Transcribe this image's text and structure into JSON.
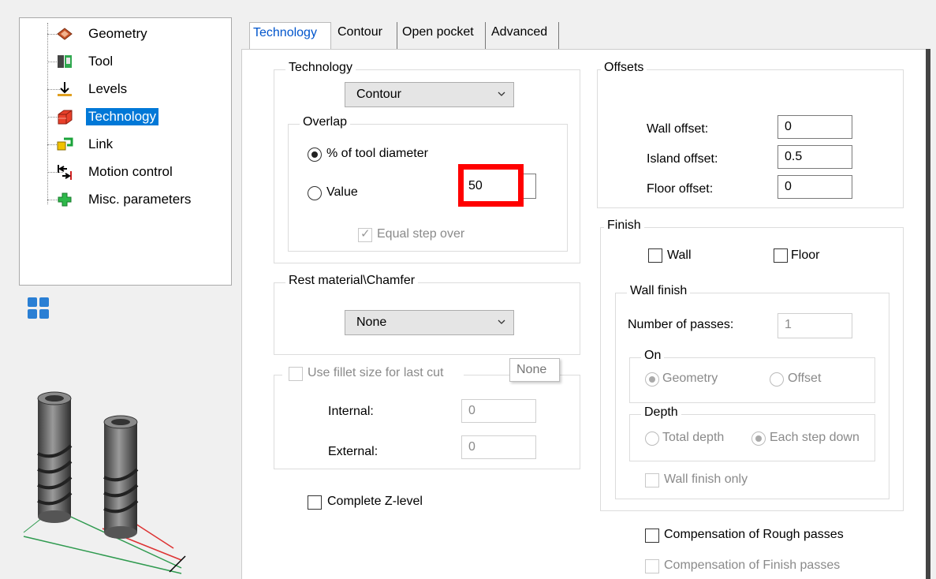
{
  "tree": {
    "items": [
      {
        "label": "Geometry",
        "icon": "geometry-icon"
      },
      {
        "label": "Tool",
        "icon": "tool-icon"
      },
      {
        "label": "Levels",
        "icon": "levels-icon"
      },
      {
        "label": "Technology",
        "icon": "technology-icon",
        "selected": true
      },
      {
        "label": "Link",
        "icon": "link-icon"
      },
      {
        "label": "Motion control",
        "icon": "motion-control-icon"
      },
      {
        "label": "Misc. parameters",
        "icon": "misc-parameters-icon"
      }
    ],
    "selected_color": "#0078d7"
  },
  "tabs": [
    "Technology",
    "Contour",
    "Open pocket",
    "Advanced"
  ],
  "technology": {
    "title": "Technology",
    "mode": "Contour",
    "overlap": {
      "title": "Overlap",
      "pct_label": "% of tool diameter",
      "value_label": "Value",
      "value": "50",
      "equal_step": "Equal step over"
    }
  },
  "rest": {
    "title": "Rest material\\Chamfer",
    "value": "None"
  },
  "fillet": {
    "label": "Use fillet size for last cut",
    "tooltip": "None",
    "internal_label": "Internal:",
    "internal": "0",
    "external_label": "External:",
    "external": "0"
  },
  "complete_z": "Complete Z-level",
  "offsets": {
    "title": "Offsets",
    "wall_label": "Wall offset:",
    "wall": "0",
    "island_label": "Island offset:",
    "island": "0.5",
    "floor_label": "Floor offset:",
    "floor": "0"
  },
  "finish": {
    "title": "Finish",
    "wall": "Wall",
    "floor": "Floor",
    "wall_finish": {
      "title": "Wall finish",
      "passes_label": "Number of passes:",
      "passes": "1",
      "on_title": "On",
      "geometry": "Geometry",
      "offset": "Offset",
      "depth_title": "Depth",
      "total_depth": "Total depth",
      "each_step": "Each step down",
      "wall_only": "Wall finish only"
    }
  },
  "comp_rough": "Compensation of Rough  passes",
  "comp_finish": "Compensation of Finish passes",
  "highlight_color": "#ff0000"
}
